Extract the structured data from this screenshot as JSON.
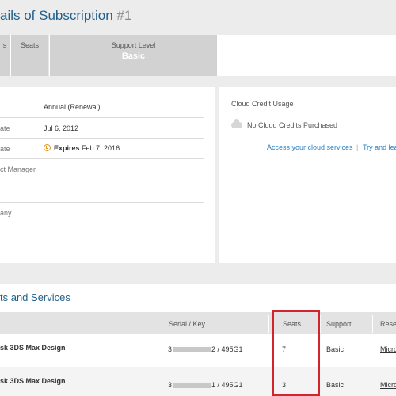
{
  "header": {
    "title": "ails of Subscription ",
    "number": "#1"
  },
  "tabs": [
    {
      "label": "s",
      "value": ""
    },
    {
      "label": "Seats",
      "value": ""
    },
    {
      "label": "Support Level",
      "value": "Basic"
    }
  ],
  "details": {
    "rows": [
      {
        "label": "",
        "value": "Annual (Renewal)"
      },
      {
        "label": "ate",
        "value": "Jul 6, 2012"
      },
      {
        "label": "ate",
        "value_strong": "Expires",
        "value": " Feb 7, 2016"
      },
      {
        "label": "ct Manager",
        "value": ""
      },
      {
        "label": "any",
        "value": ""
      }
    ]
  },
  "cloud": {
    "title": "Cloud Credit Usage",
    "empty_text": "No Cloud Credits Purchased",
    "link_access": "Access your cloud services",
    "separator": "|",
    "link_try": "Try and lea"
  },
  "products": {
    "title": "ts and Services",
    "columns": [
      "Serial / Key",
      "Seats",
      "Support",
      "Rese"
    ],
    "rows": [
      {
        "product": "sk 3DS Max Design",
        "serial_prefix": "3",
        "serial_suffix": "2 / 495G1",
        "seats": "7",
        "support": "Basic",
        "reseller": "Micro"
      },
      {
        "product": "sk 3DS Max Design",
        "serial_prefix": "3",
        "serial_suffix": "1 / 495G1",
        "seats": "3",
        "support": "Basic",
        "reseller": "Micro"
      }
    ]
  },
  "colors": {
    "accent": "#1f5f8b",
    "link": "#2a82c4",
    "highlight": "#d3232c",
    "warning": "#e3941b"
  }
}
